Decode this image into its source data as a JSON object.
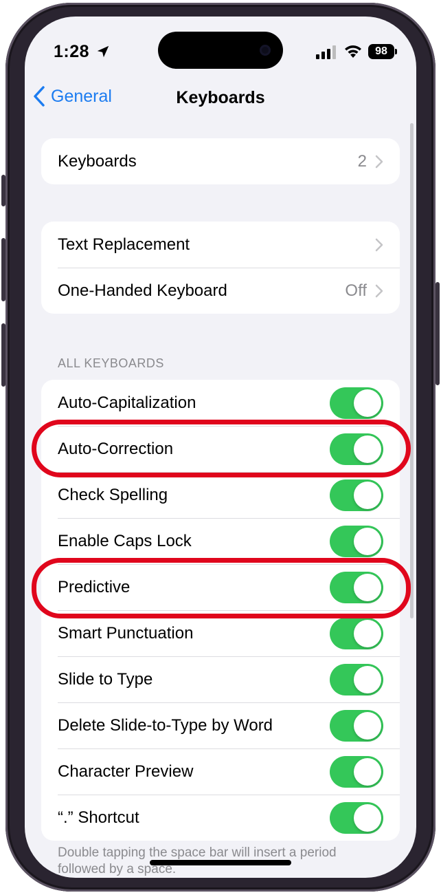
{
  "status_bar": {
    "time": "1:28",
    "battery_level": "98"
  },
  "nav": {
    "back_label": "General",
    "title": "Keyboards"
  },
  "group_keyboards": {
    "label": "Keyboards",
    "value": "2"
  },
  "group_text": {
    "text_replacement": "Text Replacement",
    "one_handed_label": "One-Handed Keyboard",
    "one_handed_value": "Off"
  },
  "all_keyboards": {
    "header": "ALL KEYBOARDS",
    "toggles": [
      {
        "label": "Auto-Capitalization",
        "on": true
      },
      {
        "label": "Auto-Correction",
        "on": true
      },
      {
        "label": "Check Spelling",
        "on": true
      },
      {
        "label": "Enable Caps Lock",
        "on": true
      },
      {
        "label": "Predictive",
        "on": true
      },
      {
        "label": "Smart Punctuation",
        "on": true
      },
      {
        "label": "Slide to Type",
        "on": true
      },
      {
        "label": "Delete Slide-to-Type by Word",
        "on": true
      },
      {
        "label": "Character Preview",
        "on": true
      },
      {
        "label": "“.” Shortcut",
        "on": true
      }
    ]
  },
  "footer_note": "Double tapping the space bar will insert a period followed by a space.",
  "colors": {
    "toggle_on": "#34c759",
    "link_blue": "#1c7cf0",
    "highlight_red": "#e0061c",
    "background": "#f2f2f7"
  }
}
